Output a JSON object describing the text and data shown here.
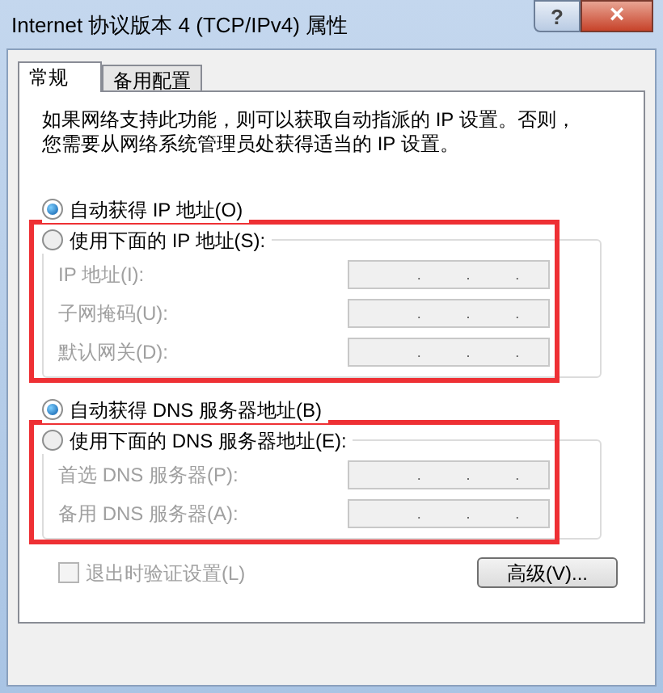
{
  "window": {
    "title": "Internet 协议版本 4 (TCP/IPv4) 属性",
    "help_label": "?",
    "close_label": "×"
  },
  "tabs": [
    {
      "label": "常规",
      "selected": true
    },
    {
      "label": "备用配置",
      "selected": false
    }
  ],
  "description": "如果网络支持此功能，则可以获取自动指派的 IP 设置。否则，您需要从网络系统管理员处获得适当的 IP 设置。",
  "ip_section": {
    "options": [
      {
        "label": "自动获得 IP 地址(O)",
        "selected": true
      },
      {
        "label": "使用下面的 IP 地址(S):",
        "selected": false
      }
    ],
    "highlighted": true,
    "disabled": true,
    "fields": [
      {
        "label": "IP 地址(I):",
        "separators": [
          ".",
          ".",
          "."
        ]
      },
      {
        "label": "子网掩码(U):",
        "separators": [
          ".",
          ".",
          "."
        ]
      },
      {
        "label": "默认网关(D):",
        "separators": [
          ".",
          ".",
          "."
        ]
      }
    ]
  },
  "dns_section": {
    "options": [
      {
        "label": "自动获得 DNS 服务器地址(B)",
        "selected": true
      },
      {
        "label": "使用下面的 DNS 服务器地址(E):",
        "selected": false
      }
    ],
    "highlighted": true,
    "disabled": true,
    "fields": [
      {
        "label": "首选 DNS 服务器(P):",
        "separators": [
          ".",
          ".",
          "."
        ]
      },
      {
        "label": "备用 DNS 服务器(A):",
        "separators": [
          ".",
          ".",
          "."
        ]
      }
    ]
  },
  "validate_checkbox": {
    "label": "退出时验证设置(L)",
    "checked": false,
    "disabled": true
  },
  "advanced_button": {
    "label": "高级(V)..."
  }
}
